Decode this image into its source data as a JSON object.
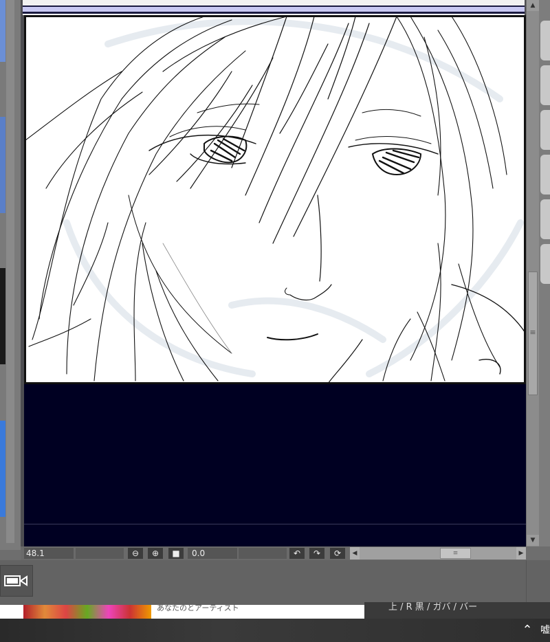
{
  "status_bar": {
    "zoom_value": "48.1",
    "zoom_out_icon": "⊖",
    "zoom_in_icon": "⊕",
    "fit_icon": "■",
    "rotation_value": "0.0",
    "rotate_left_icon": "↶",
    "rotate_right_icon": "↷",
    "reset_rotation_icon": "⟳"
  },
  "scrollbars": {
    "up_arrow": "▲",
    "down_arrow": "▼",
    "left_arrow": "◀",
    "right_arrow": "▶",
    "grip": "≡"
  },
  "lower_panel": {
    "camera_icon": "camera-icon"
  },
  "background_window": {
    "partial_text_left": "あなたのとアーティスト",
    "partial_text_right": "上 / R 黒 / ガバ / バー"
  },
  "taskbar": {
    "tray_chevron": "⌃",
    "tray_icon": "嘘"
  }
}
